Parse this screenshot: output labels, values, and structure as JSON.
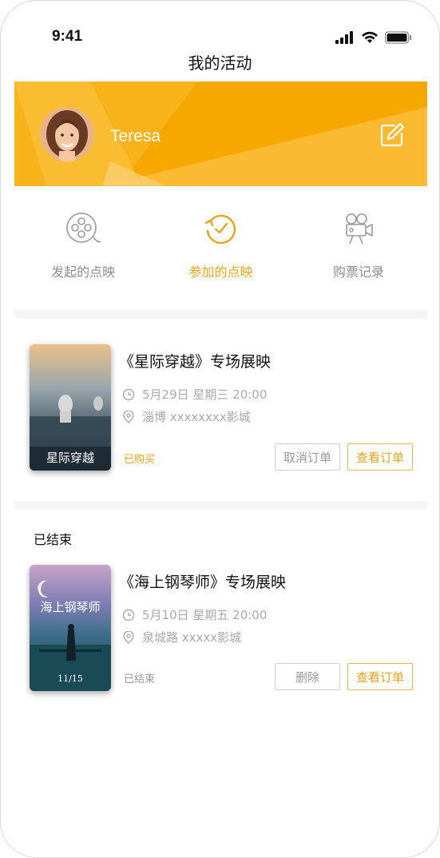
{
  "status_bar": {
    "time": "9:41"
  },
  "header": {
    "title": "我的活动"
  },
  "profile": {
    "name": "Teresa"
  },
  "colors": {
    "accent": "#f6a800",
    "accent_text": "#e7a51a",
    "muted": "#8c8c8c"
  },
  "tabs": [
    {
      "label": "发起的点映",
      "icon": "film-reel-icon",
      "active": false
    },
    {
      "label": "参加的点映",
      "icon": "clock-refresh-icon",
      "active": true
    },
    {
      "label": "购票记录",
      "icon": "movie-camera-icon",
      "active": false
    }
  ],
  "events": [
    {
      "title": "《星际穿越》专场展映",
      "datetime": "5月29日 星期三 20:00",
      "location": "淄博 xxxxxxxx影城",
      "status": "已购买",
      "actions": [
        "取消订单",
        "查看订单"
      ],
      "poster_text": "星际穿越"
    },
    {
      "title": "《海上钢琴师》专场展映",
      "datetime": "5月10日 星期五 20:00",
      "location": "泉城路 xxxxx影城",
      "status": "已结束",
      "actions": [
        "删除",
        "查看订单"
      ],
      "poster_text": "海上钢琴师",
      "poster_date": "11/15"
    }
  ],
  "sections": {
    "ended_label": "已结束"
  }
}
